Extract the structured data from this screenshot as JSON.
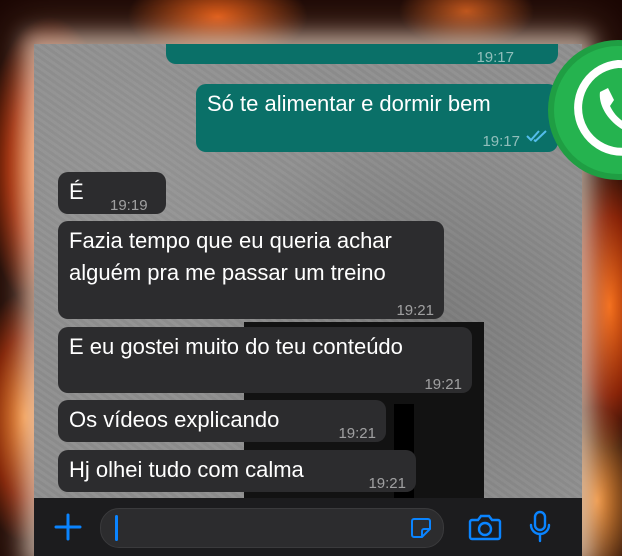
{
  "colors": {
    "outgoing_bubble": "#0a7068",
    "incoming_bubble": "#2c2c2e",
    "read_ticks": "#53bdeb",
    "accent": "#0a84ff",
    "whatsapp_green": "#25d366"
  },
  "messages": [
    {
      "direction": "outgoing",
      "text": "Só te alimentar e dormir bem",
      "time": "19:17",
      "status": "read"
    },
    {
      "direction": "incoming",
      "text": "É",
      "time": "19:19"
    },
    {
      "direction": "incoming",
      "text_line1": "Fazia tempo que eu queria achar",
      "text_line2": "alguém pra me passar um treino",
      "time": "19:21"
    },
    {
      "direction": "incoming",
      "text": "E eu gostei muito do teu conteúdo",
      "time": "19:21"
    },
    {
      "direction": "incoming",
      "text": "Os vídeos explicando",
      "time": "19:21"
    },
    {
      "direction": "incoming",
      "text": "Hj olhei tudo com calma",
      "time": "19:21"
    }
  ],
  "input_bar": {
    "icons": [
      "plus-icon",
      "sticker-icon",
      "camera-icon",
      "microphone-icon"
    ],
    "value": ""
  },
  "overlay": {
    "icon": "whatsapp-logo-icon"
  }
}
